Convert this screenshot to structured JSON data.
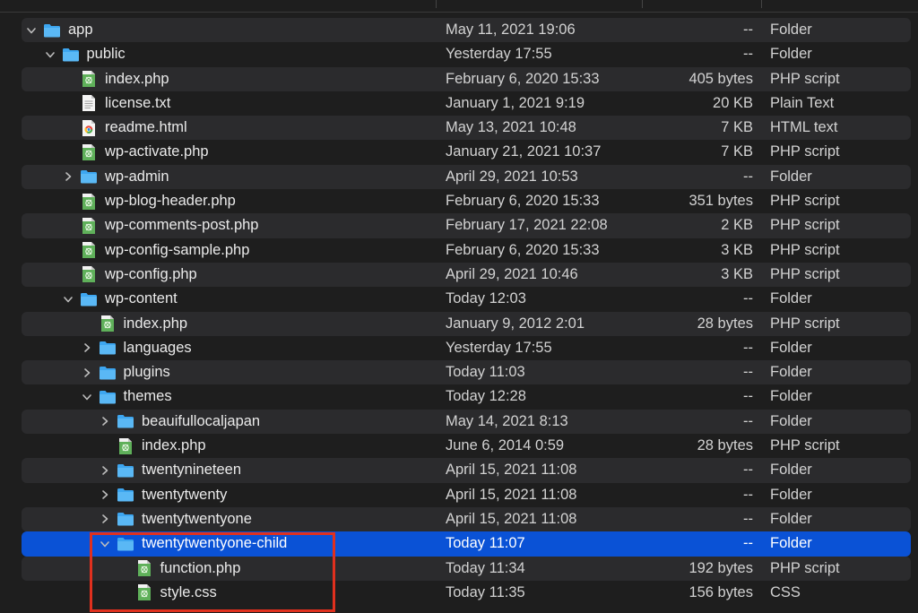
{
  "rows": [
    {
      "name": "app",
      "date": "May 11, 2021 19:06",
      "size": "--",
      "kind": "Folder",
      "depth": 0,
      "type": "folder",
      "chevron": "open"
    },
    {
      "name": "public",
      "date": "Yesterday 17:55",
      "size": "--",
      "kind": "Folder",
      "depth": 1,
      "type": "folder",
      "chevron": "open"
    },
    {
      "name": "index.php",
      "date": "February 6, 2020 15:33",
      "size": "405 bytes",
      "kind": "PHP script",
      "depth": 2,
      "type": "php"
    },
    {
      "name": "license.txt",
      "date": "January 1, 2021 9:19",
      "size": "20 KB",
      "kind": "Plain Text",
      "depth": 2,
      "type": "txt"
    },
    {
      "name": "readme.html",
      "date": "May 13, 2021 10:48",
      "size": "7 KB",
      "kind": "HTML text",
      "depth": 2,
      "type": "html"
    },
    {
      "name": "wp-activate.php",
      "date": "January 21, 2021 10:37",
      "size": "7 KB",
      "kind": "PHP script",
      "depth": 2,
      "type": "php"
    },
    {
      "name": "wp-admin",
      "date": "April 29, 2021 10:53",
      "size": "--",
      "kind": "Folder",
      "depth": 2,
      "type": "folder",
      "chevron": "closed"
    },
    {
      "name": "wp-blog-header.php",
      "date": "February 6, 2020 15:33",
      "size": "351 bytes",
      "kind": "PHP script",
      "depth": 2,
      "type": "php"
    },
    {
      "name": "wp-comments-post.php",
      "date": "February 17, 2021 22:08",
      "size": "2 KB",
      "kind": "PHP script",
      "depth": 2,
      "type": "php"
    },
    {
      "name": "wp-config-sample.php",
      "date": "February 6, 2020 15:33",
      "size": "3 KB",
      "kind": "PHP script",
      "depth": 2,
      "type": "php"
    },
    {
      "name": "wp-config.php",
      "date": "April 29, 2021 10:46",
      "size": "3 KB",
      "kind": "PHP script",
      "depth": 2,
      "type": "php"
    },
    {
      "name": "wp-content",
      "date": "Today 12:03",
      "size": "--",
      "kind": "Folder",
      "depth": 2,
      "type": "folder",
      "chevron": "open"
    },
    {
      "name": "index.php",
      "date": "January 9, 2012 2:01",
      "size": "28 bytes",
      "kind": "PHP script",
      "depth": 3,
      "type": "php"
    },
    {
      "name": "languages",
      "date": "Yesterday 17:55",
      "size": "--",
      "kind": "Folder",
      "depth": 3,
      "type": "folder",
      "chevron": "closed"
    },
    {
      "name": "plugins",
      "date": "Today 11:03",
      "size": "--",
      "kind": "Folder",
      "depth": 3,
      "type": "folder",
      "chevron": "closed"
    },
    {
      "name": "themes",
      "date": "Today 12:28",
      "size": "--",
      "kind": "Folder",
      "depth": 3,
      "type": "folder",
      "chevron": "open"
    },
    {
      "name": "beauifullocaljapan",
      "date": "May 14, 2021 8:13",
      "size": "--",
      "kind": "Folder",
      "depth": 4,
      "type": "folder",
      "chevron": "closed"
    },
    {
      "name": "index.php",
      "date": "June 6, 2014 0:59",
      "size": "28 bytes",
      "kind": "PHP script",
      "depth": 4,
      "type": "php"
    },
    {
      "name": "twentynineteen",
      "date": "April 15, 2021 11:08",
      "size": "--",
      "kind": "Folder",
      "depth": 4,
      "type": "folder",
      "chevron": "closed"
    },
    {
      "name": "twentytwenty",
      "date": "April 15, 2021 11:08",
      "size": "--",
      "kind": "Folder",
      "depth": 4,
      "type": "folder",
      "chevron": "closed"
    },
    {
      "name": "twentytwentyone",
      "date": "April 15, 2021 11:08",
      "size": "--",
      "kind": "Folder",
      "depth": 4,
      "type": "folder",
      "chevron": "closed"
    },
    {
      "name": "twentytwentyone-child",
      "date": "Today 11:07",
      "size": "--",
      "kind": "Folder",
      "depth": 4,
      "type": "folder",
      "chevron": "open",
      "selected": true
    },
    {
      "name": "function.php",
      "date": "Today 11:34",
      "size": "192 bytes",
      "kind": "PHP script",
      "depth": 5,
      "type": "php"
    },
    {
      "name": "style.css",
      "date": "Today 11:35",
      "size": "156 bytes",
      "kind": "CSS",
      "depth": 5,
      "type": "css"
    }
  ],
  "colors": {
    "selection": "#0a52d6",
    "folder": "#3da6f0",
    "highlight_box": "#e0301e"
  }
}
